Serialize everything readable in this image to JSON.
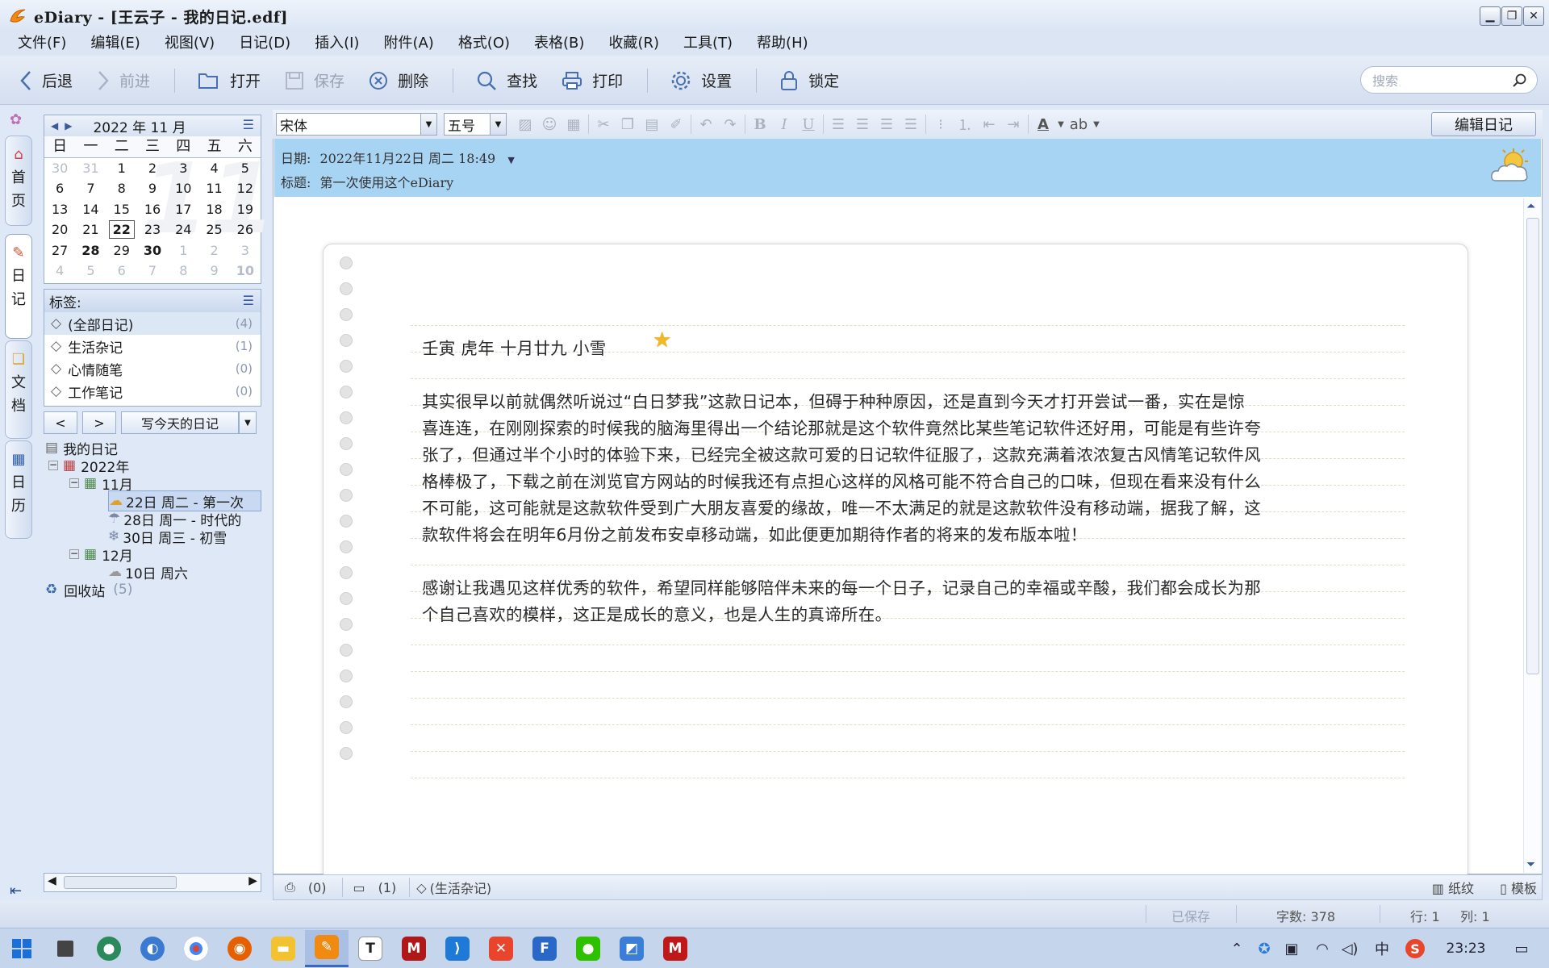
{
  "window": {
    "title": "eDiary - [王云子 - 我的日记.edf]"
  },
  "menu": [
    "文件(F)",
    "编辑(E)",
    "视图(V)",
    "日记(D)",
    "插入(I)",
    "附件(A)",
    "格式(O)",
    "表格(B)",
    "收藏(R)",
    "工具(T)",
    "帮助(H)"
  ],
  "toolbar": {
    "back": "后退",
    "forward": "前进",
    "open": "打开",
    "save": "保存",
    "delete": "删除",
    "find": "查找",
    "print": "打印",
    "settings": "设置",
    "lock": "锁定"
  },
  "search": {
    "placeholder": "搜索"
  },
  "side_tabs": [
    {
      "label": "首页",
      "chars": [
        "首",
        "页"
      ]
    },
    {
      "label": "日记",
      "chars": [
        "日",
        "记"
      ]
    },
    {
      "label": "文档",
      "chars": [
        "文",
        "档"
      ]
    },
    {
      "label": "日历",
      "chars": [
        "日",
        "历"
      ]
    }
  ],
  "calendar": {
    "header": "2022 年 11 月",
    "weekdays": [
      "日",
      "一",
      "二",
      "三",
      "四",
      "五",
      "六"
    ],
    "watermark": "11",
    "weeks": [
      [
        {
          "d": "30",
          "dim": true
        },
        {
          "d": "31",
          "dim": true
        },
        {
          "d": "1"
        },
        {
          "d": "2"
        },
        {
          "d": "3"
        },
        {
          "d": "4"
        },
        {
          "d": "5"
        }
      ],
      [
        {
          "d": "6"
        },
        {
          "d": "7"
        },
        {
          "d": "8"
        },
        {
          "d": "9"
        },
        {
          "d": "10"
        },
        {
          "d": "11"
        },
        {
          "d": "12"
        }
      ],
      [
        {
          "d": "13"
        },
        {
          "d": "14"
        },
        {
          "d": "15"
        },
        {
          "d": "16"
        },
        {
          "d": "17"
        },
        {
          "d": "18"
        },
        {
          "d": "19"
        }
      ],
      [
        {
          "d": "20"
        },
        {
          "d": "21"
        },
        {
          "d": "22",
          "today": true
        },
        {
          "d": "23"
        },
        {
          "d": "24"
        },
        {
          "d": "25"
        },
        {
          "d": "26"
        }
      ],
      [
        {
          "d": "27"
        },
        {
          "d": "28",
          "bold": true
        },
        {
          "d": "29"
        },
        {
          "d": "30",
          "bold": true
        },
        {
          "d": "1",
          "dim": true
        },
        {
          "d": "2",
          "dim": true
        },
        {
          "d": "3",
          "dim": true
        }
      ],
      [
        {
          "d": "4",
          "dim": true
        },
        {
          "d": "5",
          "dim": true
        },
        {
          "d": "6",
          "dim": true
        },
        {
          "d": "7",
          "dim": true
        },
        {
          "d": "8",
          "dim": true
        },
        {
          "d": "9",
          "dim": true
        },
        {
          "d": "10",
          "dim": true,
          "bold": true
        }
      ]
    ]
  },
  "tags": {
    "title": "标签:",
    "items": [
      {
        "label": "(全部日记)",
        "count": "(4)"
      },
      {
        "label": "生活杂记",
        "count": "(1)"
      },
      {
        "label": "心情随笔",
        "count": "(0)"
      },
      {
        "label": "工作笔记",
        "count": "(0)"
      }
    ]
  },
  "nav": {
    "prev": "<",
    "next": ">",
    "write_today": "写今天的日记"
  },
  "tree": {
    "root": "我的日记",
    "year": "2022年",
    "nov": "11月",
    "e1": "22日 周二 - 第一次",
    "e2": "28日 周一 - 时代的",
    "e3": "30日 周三 - 初雪",
    "dec": "12月",
    "e4": "10日 周六",
    "recycle": "回收站",
    "recycle_count": "(5)"
  },
  "format": {
    "font": "宋体",
    "size": "五号",
    "edit_button": "编辑日记"
  },
  "entry": {
    "date_label": "日期:",
    "date": "2022年11月22日 周二 18:49",
    "title_label": "标题:",
    "title": "第一次使用这个eDiary",
    "weather": "partly-cloudy",
    "lines": [
      "壬寅 虎年 十月廿九 小雪",
      "其实很早以前就偶然听说过“白日梦我”这款日记本，但碍于种种原因，还是直到今天才打开尝试一番，实在是惊",
      "喜连连，在刚刚探索的时候我的脑海里得出一个结论那就是这个软件竟然比某些笔记软件还好用，可能是有些许夸",
      "张了，但通过半个小时的体验下来，已经完全被这款可爱的日记软件征服了，这款充满着浓浓复古风情笔记软件风",
      "格棒极了，下载之前在浏览官方网站的时候我还有点担心这样的风格可能不符合自己的口味，但现在看来没有什么",
      "不可能，这可能就是这款软件受到广大朋友喜爱的缘故，唯一不太满足的就是这款软件没有移动端，据我了解，这",
      "款软件将会在明年6月份之前发布安卓移动端，如此便更加期待作者的将来的发布版本啦！",
      "感谢让我遇见这样优秀的软件，希望同样能够陪伴未来的每一个日子，记录自己的幸福或辛酸，我们都会成长为那",
      "个自己喜欢的模样，这正是成长的意义，也是人生的真谛所在。"
    ]
  },
  "editor_status": {
    "attach": "(0)",
    "comments": "(1)",
    "tag": "(生活杂记)",
    "paper": "纸纹",
    "template": "模板"
  },
  "status": {
    "saved": "已保存",
    "words": "字数: 378",
    "row": "行: 1",
    "col": "列: 1"
  },
  "clock": "23:23",
  "ime": "中",
  "colors": {
    "accent": "#a8d4f4",
    "frame": "#dfe8f6",
    "paper_rule": "#dde0c8"
  }
}
